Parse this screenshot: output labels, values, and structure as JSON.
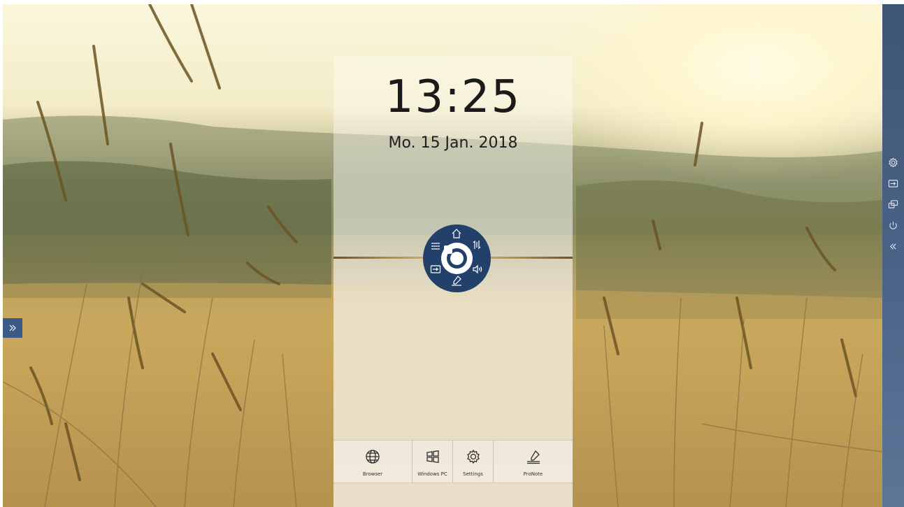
{
  "clock": {
    "time": "13:25",
    "date": "Mo. 15 Jan. 2018"
  },
  "radial_menu": {
    "items": [
      {
        "icon": "home-icon"
      },
      {
        "icon": "source-switch-icon"
      },
      {
        "icon": "volume-icon"
      },
      {
        "icon": "annotate-pen-icon"
      },
      {
        "icon": "input-source-icon"
      },
      {
        "icon": "menu-icon"
      }
    ],
    "center_icon": "toolbox-icon"
  },
  "apps": [
    {
      "label": "Browser",
      "icon": "globe-icon"
    },
    {
      "label": "Windows PC",
      "icon": "windows-icon"
    },
    {
      "label": "Settings",
      "icon": "gear-icon"
    },
    {
      "label": "ProNote",
      "icon": "pen-note-icon"
    }
  ],
  "right_sidebar": {
    "items": [
      {
        "icon": "gear-icon"
      },
      {
        "icon": "input-source-icon"
      },
      {
        "icon": "screen-share-icon"
      },
      {
        "icon": "power-icon"
      },
      {
        "icon": "collapse-icon"
      }
    ]
  },
  "left_tab": {
    "icon": "expand-icon"
  },
  "colors": {
    "radial_menu_bg": "#22406a",
    "sidebar_bg": "#4a6285",
    "left_tab_bg": "#3b5a88"
  }
}
